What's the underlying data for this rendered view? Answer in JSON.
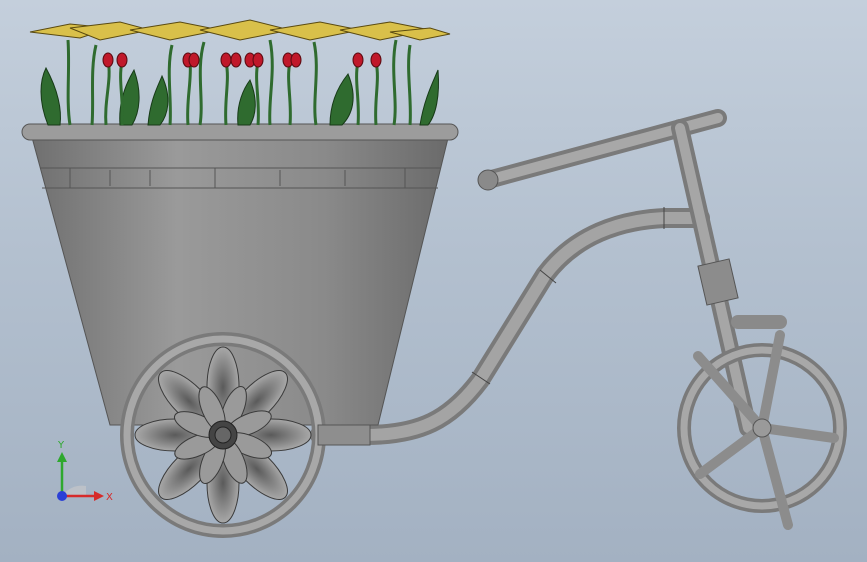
{
  "viewport": {
    "model_description_hidden": true,
    "triad": {
      "x_label": "X",
      "y_label": "Y",
      "x_color": "#d62a2a",
      "y_color": "#2ea82e",
      "z_color": "#2a3fd6"
    }
  },
  "colors": {
    "background_top": "#c4cfdc",
    "background_bottom": "#a3b1c2",
    "metal": "#8e8e8e",
    "leaf": "#2f6b2f",
    "bud": "#c0182a",
    "petal": "#d9c04a"
  }
}
